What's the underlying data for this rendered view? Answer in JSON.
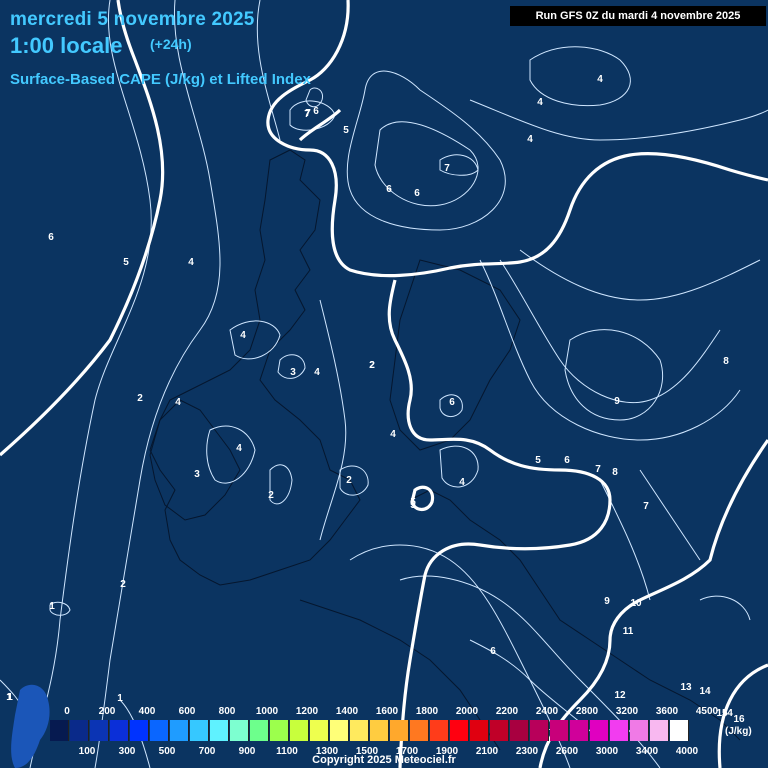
{
  "header": {
    "date": "mercredi 5 novembre 2025",
    "time": "1:00 locale",
    "offset": "(+24h)",
    "product": "Surface-Based CAPE (J/kg) et Lifted Index"
  },
  "run_info": "Run GFS 0Z du mardi 4 novembre 2025",
  "legend": {
    "unit": "(J/kg)",
    "upper_ticks": [
      "0",
      "200",
      "400",
      "600",
      "800",
      "1000",
      "1200",
      "1400",
      "1600",
      "1800",
      "2000",
      "2200",
      "2400",
      "2800",
      "3200",
      "3600",
      "4500"
    ],
    "lower_ticks": [
      "100",
      "300",
      "500",
      "700",
      "900",
      "1100",
      "1300",
      "1500",
      "1700",
      "1900",
      "2100",
      "2300",
      "2600",
      "3000",
      "3400",
      "4000"
    ],
    "colors": [
      "#061a50",
      "#0a2a8a",
      "#0b34b4",
      "#0b2fd8",
      "#0033ff",
      "#0a66ff",
      "#1f9cff",
      "#36c8ff",
      "#5ff2ff",
      "#7dffd0",
      "#6dff8c",
      "#9cff4c",
      "#c8ff3c",
      "#eeff4e",
      "#ffff78",
      "#ffea5e",
      "#ffcc40",
      "#ffa82c",
      "#ff7820",
      "#ff3c1a",
      "#ff0010",
      "#e00010",
      "#c00028",
      "#a80040",
      "#b8005a",
      "#c8007a",
      "#d0009a",
      "#e000c0",
      "#f23cf0",
      "#f07ae6",
      "#f8b8f0",
      "#ffffff"
    ]
  },
  "map": {
    "lifted_index_labels": [
      "7",
      "6",
      "5",
      "6",
      "7",
      "6",
      "7",
      "4",
      "4",
      "4",
      "4",
      "6",
      "5",
      "4",
      "4",
      "2",
      "3",
      "2",
      "2",
      "4",
      "3",
      "4",
      "6",
      "4",
      "2",
      "2",
      "4",
      "5",
      "5",
      "6",
      "7",
      "8",
      "9",
      "8",
      "7",
      "9",
      "10",
      "11",
      "12",
      "13",
      "14",
      "15",
      "16",
      "6",
      "2",
      "1",
      "1",
      "1",
      "4",
      "5",
      "1",
      "13"
    ]
  },
  "copyright": "Copyright 2025 Meteociel.fr"
}
